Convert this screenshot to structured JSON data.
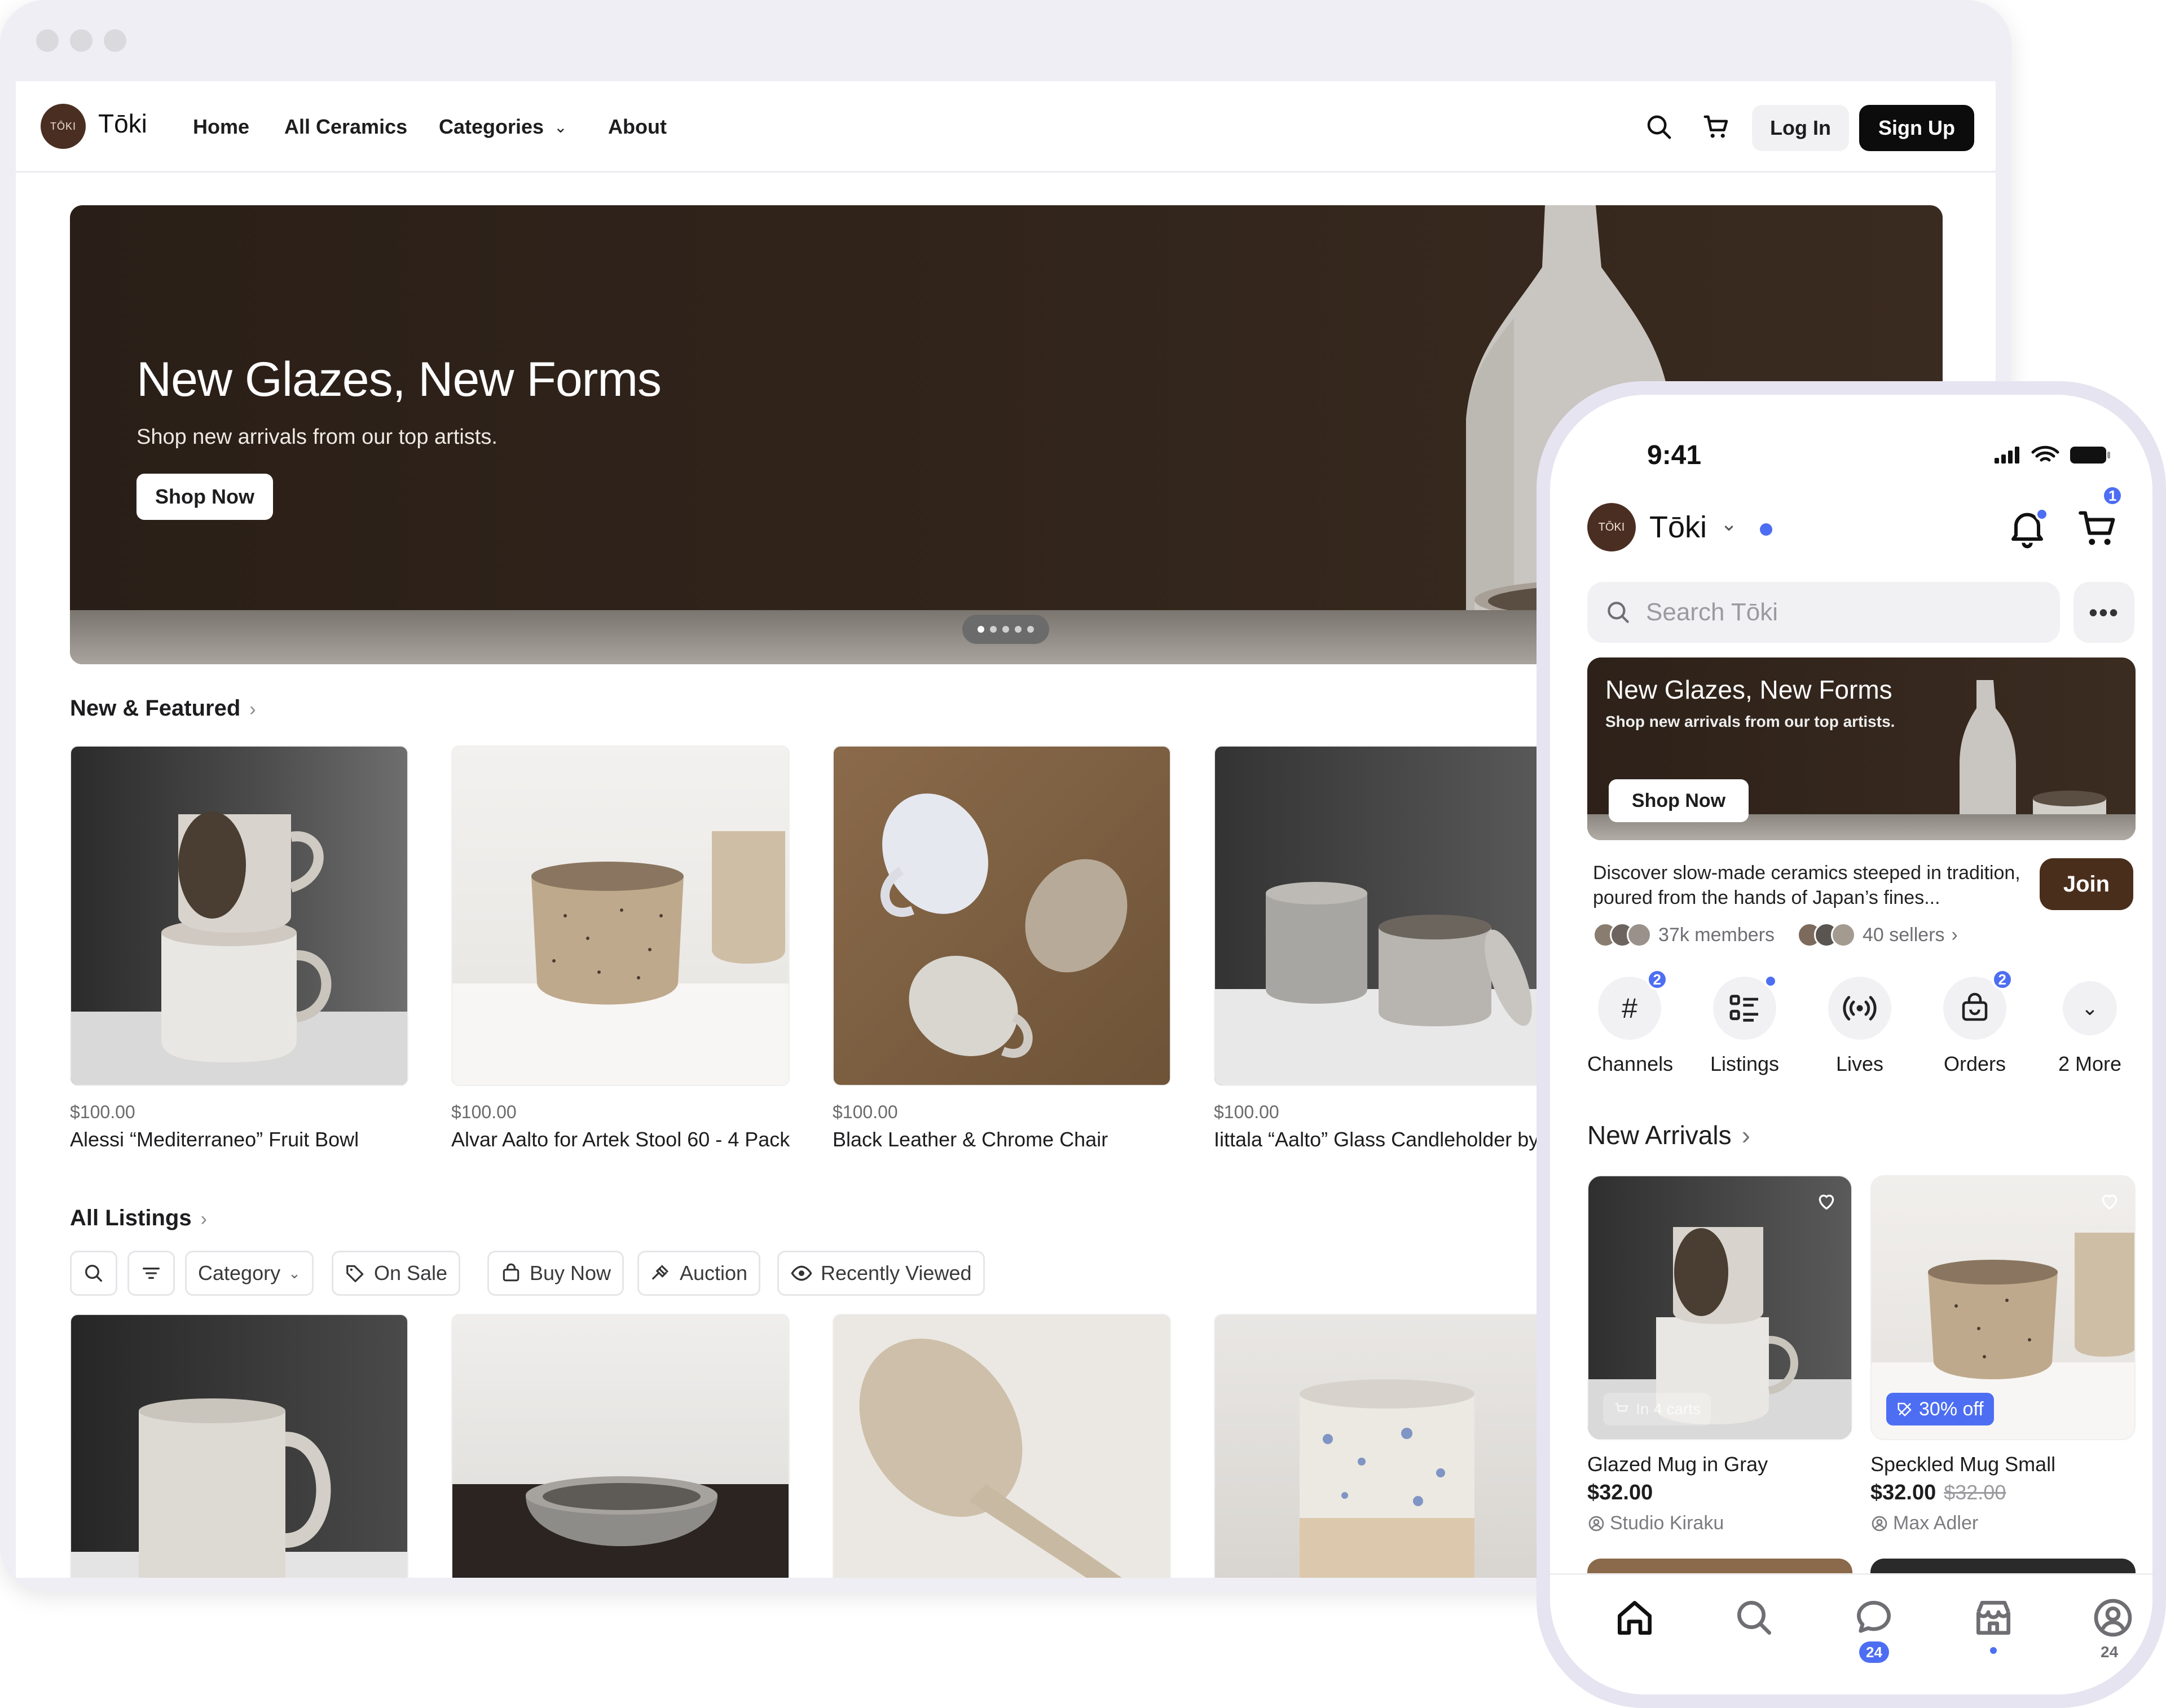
{
  "desktop": {
    "brand": "Tōki",
    "logo_text": "TŌKI",
    "nav": {
      "home": "Home",
      "all_ceramics": "All Ceramics",
      "categories": "Categories",
      "about": "About",
      "login": "Log In",
      "signup": "Sign Up"
    },
    "hero": {
      "title": "New Glazes, New Forms",
      "subtitle": "Shop new arrivals from our top artists.",
      "cta": "Shop Now",
      "slides": 5,
      "active_slide": 1
    },
    "featured": {
      "title": "New & Featured",
      "items": [
        {
          "price": "$100.00",
          "name": "Alessi “Mediterraneo” Fruit Bowl"
        },
        {
          "price": "$100.00",
          "name": "Alvar Aalto for Artek Stool 60 - 4 Pack"
        },
        {
          "price": "$100.00",
          "name": "Black Leather & Chrome Chair"
        },
        {
          "price": "$100.00",
          "name": "Iittala “Aalto” Glass Candleholder by"
        }
      ]
    },
    "all_listings": {
      "title": "All Listings",
      "filters": {
        "category": "Category",
        "on_sale": "On Sale",
        "buy_now": "Buy Now",
        "auction": "Auction",
        "recently_viewed": "Recently Viewed"
      }
    }
  },
  "phone": {
    "time": "9:41",
    "brand": "Tōki",
    "logo_text": "TŌKI",
    "cart_count": "1",
    "search_placeholder": "Search Tōki",
    "hero": {
      "title": "New Glazes, New Forms",
      "subtitle": "Shop new arrivals from our top artists.",
      "cta": "Shop Now"
    },
    "description": "Discover slow-made ceramics steeped in tradition, poured from the hands of Japan’s fines...",
    "join": "Join",
    "members": "37k members",
    "sellers": "40 sellers",
    "shortcuts": [
      {
        "label": "Channels",
        "badge": "2"
      },
      {
        "label": "Listings",
        "badge": ""
      },
      {
        "label": "Lives",
        "badge": ""
      },
      {
        "label": "Orders",
        "badge": "2"
      },
      {
        "label": "2 More",
        "badge": ""
      }
    ],
    "new_arrivals": {
      "title": "New Arrivals",
      "items": [
        {
          "badge": "In 4 carts",
          "title": "Glazed Mug in Gray",
          "price": "$32.00",
          "old_price": "",
          "seller": "Studio Kiraku"
        },
        {
          "badge": "30% off",
          "title": "Speckled Mug Small",
          "price": "$32.00",
          "old_price": "$32.00",
          "seller": "Max Adler"
        }
      ]
    },
    "tabbar": {
      "messages_badge": "24",
      "profile_badge": "24"
    }
  },
  "colors": {
    "accent_blue": "#4d6ef2",
    "join_brown": "#4a2e1c",
    "signup_black": "#0c0c0d"
  }
}
